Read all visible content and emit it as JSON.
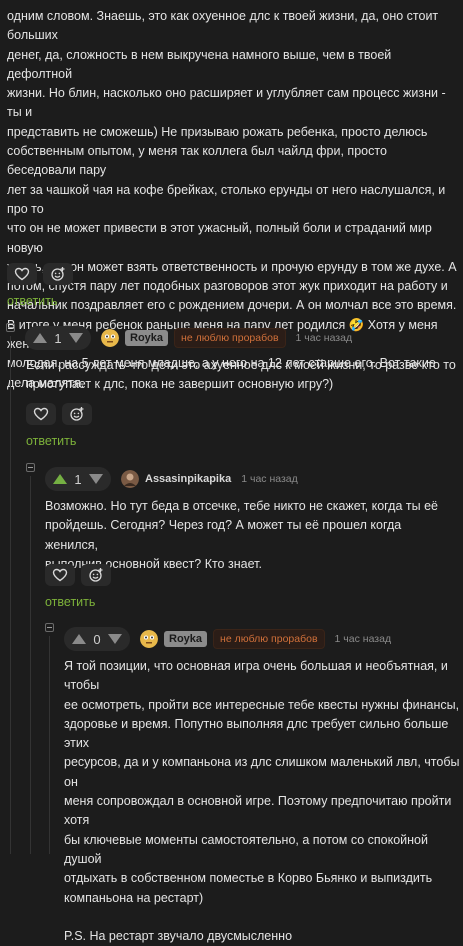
{
  "top_comment": {
    "lines": [
      "одним словом. Знаешь, это как охуенное длс к твоей жизни, да, оно стоит больших",
      "денег, да, сложность в нем выкручена намного выше, чем в твоей дефолтной",
      "жизни. Но блин, насколько оно расширяет и углубляет сам процесс жизни - ты и",
      "представить не сможешь) Не призываю рожать ребенка, просто делюсь",
      "собственным опытом, у меня так коллега был чайлд фри, просто беседовали пару",
      "лет за чашкой чая на кофе брейках, столько ерунды от него наслушался, и про то",
      "что он не может привести в этот ужасный, полный боли и страданий мир новую",
      "жизнь, как он может взять ответственность и прочую ерунду в том же духе. А",
      "потом, спустя пару лет подобных разговоров этот жук приходит на работу и",
      "начальник поздравляет его с рождением дочери. А он молчал все это время.",
      "В итоге у меня ребенок раньше меня на пару лет родился 🤣 Хотя у меня жена",
      "молодая, на 5 лет меня младше, а у него на 12 лет старше его. Вот такие",
      "дела малятя."
    ],
    "reply_label": "ответить"
  },
  "comment_1": {
    "score": "1",
    "author": "Royka",
    "tag": "не люблю прорабов",
    "time": "1 час назад",
    "lines": [
      "Если рассуждать что дети это ахуенное длс к моей жизни, то разве кто то",
      "приступает к длс, пока не завершит основную игру?)"
    ],
    "reply_label": "ответить"
  },
  "comment_2": {
    "score": "1",
    "author": "Assasinpikapika",
    "time": "1 час назад",
    "lines": [
      "Возможно. Но тут беда в отсечке, тебе никто не скажет, когда ты её",
      "пройдешь. Сегодня? Через год? А может ты её прошел когда женился,",
      "выполнив основной квест? Кто знает."
    ],
    "reply_label": "ответить"
  },
  "comment_3": {
    "score": "0",
    "author": "Royka",
    "tag": "не люблю прорабов",
    "time": "1 час назад",
    "lines": [
      "Я той позиции, что основная игра очень большая и необъятная, и чтобы",
      "ее осмотреть, пройти все интересные тебе квесты нужны финансы,",
      "здоровье и время. Попутно выполняя длс требует сильно больше этих",
      "ресурсов, да и у компаньона из длс слишком маленький лвл, чтобы он",
      "меня сопровождал в основной игре. Поэтому предпочитаю пройти хотя",
      "бы ключевые моменты самостоятельно, а потом со спокойной душой",
      "отдыхать в собственном поместье в Корво Бьянко и выпиздить",
      "компаньона на рестарт)",
      "",
      "P.S. На рестарт звучало двусмысленно"
    ]
  },
  "colors": {
    "background": "#1c1c1c",
    "reply_green": "#7db23a",
    "tag_orange": "#d0703a",
    "upvote_active": "#75b043"
  }
}
